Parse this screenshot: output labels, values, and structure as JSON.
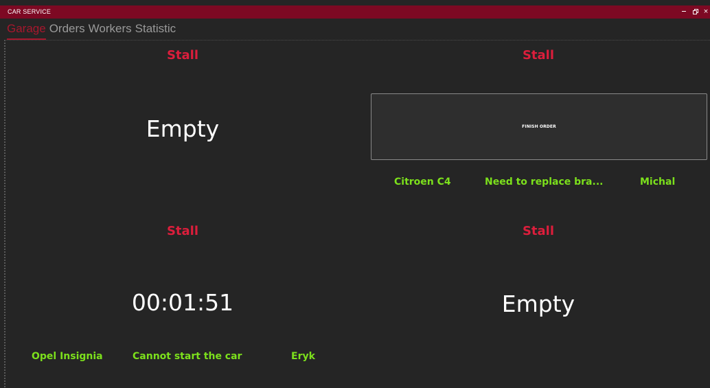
{
  "window": {
    "title": "CAR SERVICE",
    "controls": {
      "minimize": "minimize",
      "restore": "restore",
      "close": "×"
    }
  },
  "tabs": [
    {
      "label": "Garage",
      "active": true
    },
    {
      "label": "Orders",
      "active": false
    },
    {
      "label": "Workers",
      "active": false
    },
    {
      "label": "Statistic",
      "active": false
    }
  ],
  "stalls": [
    {
      "title": "Stall",
      "status": "Empty"
    },
    {
      "title": "Stall",
      "button_label": "FINISH ORDER",
      "car": "Citroen C4",
      "description": "Need to replace bra...",
      "worker": "Michal"
    },
    {
      "title": "Stall",
      "timer": "00:01:51",
      "car": "Opel Insignia",
      "description": "Cannot start the car",
      "worker": "Eryk"
    },
    {
      "title": "Stall",
      "status": "Empty"
    }
  ],
  "colors": {
    "titlebar": "#7d0923",
    "background": "#252525",
    "stall_title": "#dc1e3c",
    "info_text": "#7ce01c",
    "active_tab": "#a8172d",
    "inactive_tab": "#9a9a9a"
  }
}
